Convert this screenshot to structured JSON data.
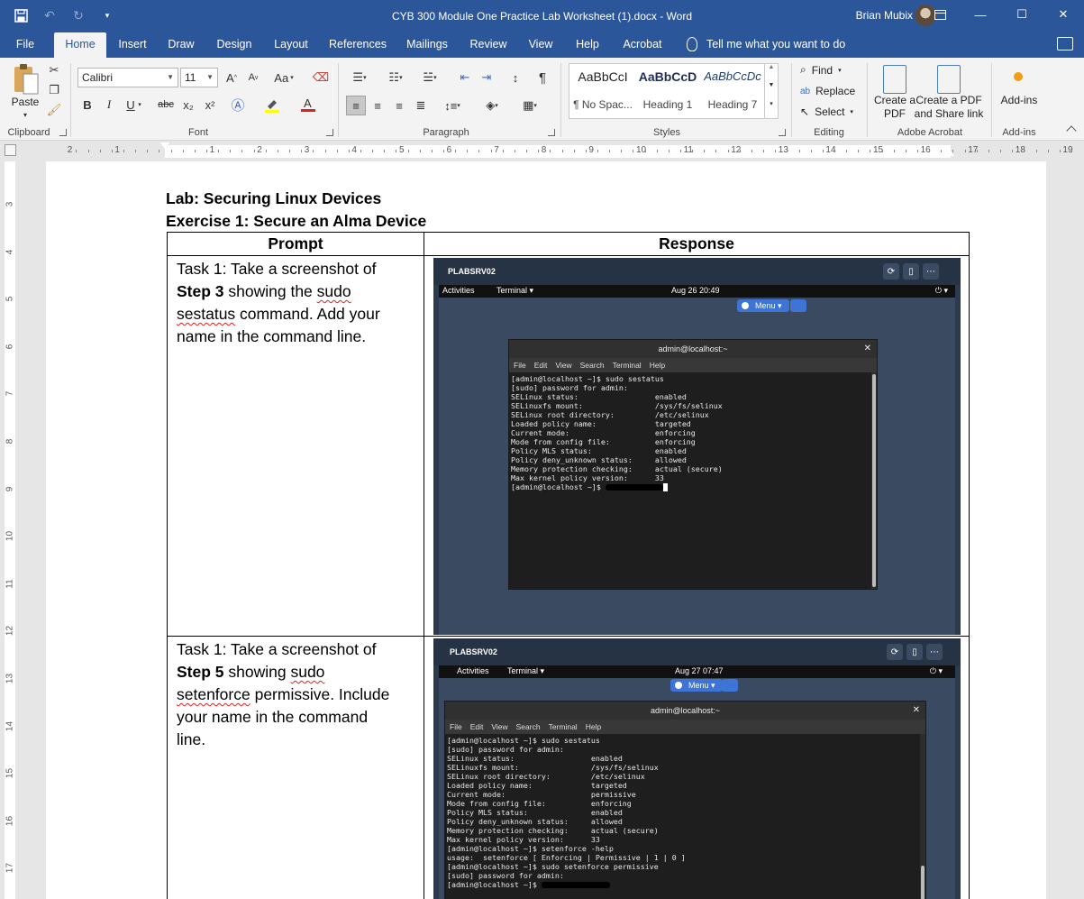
{
  "window": {
    "title": "CYB 300 Module One Practice Lab Worksheet (1).docx  -  Word",
    "user": "Brian Mubix"
  },
  "tabs": [
    "File",
    "Home",
    "Insert",
    "Draw",
    "Design",
    "Layout",
    "References",
    "Mailings",
    "Review",
    "View",
    "Help",
    "Acrobat"
  ],
  "active_tab": "Home",
  "tell_me": "Tell me what you want to do",
  "ribbon": {
    "clipboard": {
      "paste": "Paste",
      "label": "Clipboard"
    },
    "font": {
      "name": "Calibri",
      "size": "11",
      "label": "Font",
      "bold": "B",
      "italic": "I",
      "underline": "U",
      "strike": "abc",
      "sub": "x₂",
      "sup": "x²",
      "grow": "A",
      "shrink": "A",
      "case": "Aa"
    },
    "paragraph": {
      "label": "Paragraph"
    },
    "styles": {
      "label": "Styles",
      "items": [
        {
          "sample": "AaBbCcI",
          "name": "¶ No Spac..."
        },
        {
          "sample": "AaBbCcD",
          "name": "Heading 1"
        },
        {
          "sample": "AaBbCcDc",
          "name": "Heading 7"
        }
      ]
    },
    "editing": {
      "find": "Find",
      "replace": "Replace",
      "select": "Select",
      "label": "Editing"
    },
    "acrobat": {
      "create_pdf": "Create a PDF",
      "create_share": "Create a PDF and Share link",
      "label": "Adobe Acrobat"
    },
    "addins": {
      "button": "Add-ins",
      "label": "Add-ins"
    }
  },
  "document": {
    "lab_title": "Lab: Securing Linux Devices",
    "exercise_title": "Exercise 1: Secure an Alma Device",
    "table": {
      "headers": [
        "Prompt",
        "Response"
      ],
      "rows": [
        {
          "p1": "Task 1: Take a screenshot of",
          "p2_bold": "Step 3",
          "p2_rest": " showing the ",
          "p2_word": "sudo",
          "p3_word": "sestatus",
          "p3_rest": " command. Add your",
          "p4": "name in the command line."
        },
        {
          "p1": "Task 1: Take a screenshot of",
          "p2_bold": "Step 5",
          "p2_rest": " showing ",
          "p2_word": "sudo",
          "p3_word": "setenforce",
          "p3_rest": " permissive. Include",
          "p4": "your name in the command",
          "p5": "line."
        }
      ]
    }
  },
  "screenshots": [
    {
      "host": "PLABSRV02",
      "activities": "Activities",
      "app": "Terminal ▾",
      "clock": "Aug 26  20:49",
      "menu": "Menu ▾",
      "term_title": "admin@localhost:~",
      "menu_items": [
        "File",
        "Edit",
        "View",
        "Search",
        "Terminal",
        "Help"
      ],
      "lines": [
        "[admin@localhost ~]$ sudo sestatus",
        "[sudo] password for admin:",
        "SELinux status:                 enabled",
        "SELinuxfs mount:                /sys/fs/selinux",
        "SELinux root directory:         /etc/selinux",
        "Loaded policy name:             targeted",
        "Current mode:                   enforcing",
        "Mode from config file:          enforcing",
        "Policy MLS status:              enabled",
        "Policy deny_unknown status:     allowed",
        "Memory protection checking:     actual (secure)",
        "Max kernel policy version:      33"
      ],
      "prompt": "[admin@localhost ~]$ "
    },
    {
      "host": "PLABSRV02",
      "activities": "Activities",
      "app": "Terminal ▾",
      "clock": "Aug 27  07:47",
      "menu": "Menu ▾",
      "term_title": "admin@localhost:~",
      "menu_items": [
        "File",
        "Edit",
        "View",
        "Search",
        "Terminal",
        "Help"
      ],
      "lines": [
        "[admin@localhost ~]$ sudo sestatus",
        "[sudo] password for admin:",
        "SELinux status:                 enabled",
        "SELinuxfs mount:                /sys/fs/selinux",
        "SELinux root directory:         /etc/selinux",
        "Loaded policy name:             targeted",
        "Current mode:                   permissive",
        "Mode from config file:          enforcing",
        "Policy MLS status:              enabled",
        "Policy deny_unknown status:     allowed",
        "Memory protection checking:     actual (secure)",
        "Max kernel policy version:      33",
        "[admin@localhost ~]$ setenforce -help",
        "usage:  setenforce [ Enforcing | Permissive | 1 | 0 ]",
        "[admin@localhost ~]$ sudo setenforce permissive",
        "[sudo] password for admin:"
      ],
      "prompt": "[admin@localhost ~]$ "
    }
  ],
  "ruler": {
    "h": [
      "2",
      "1",
      "1",
      "2",
      "3",
      "4",
      "5",
      "6",
      "7",
      "8",
      "9",
      "10",
      "11",
      "12",
      "13",
      "14",
      "15",
      "16",
      "17",
      "18",
      "19"
    ],
    "v": [
      "3",
      "4",
      "5",
      "6",
      "7",
      "8",
      "9",
      "10",
      "11",
      "12",
      "13",
      "14",
      "15",
      "16",
      "17"
    ]
  }
}
